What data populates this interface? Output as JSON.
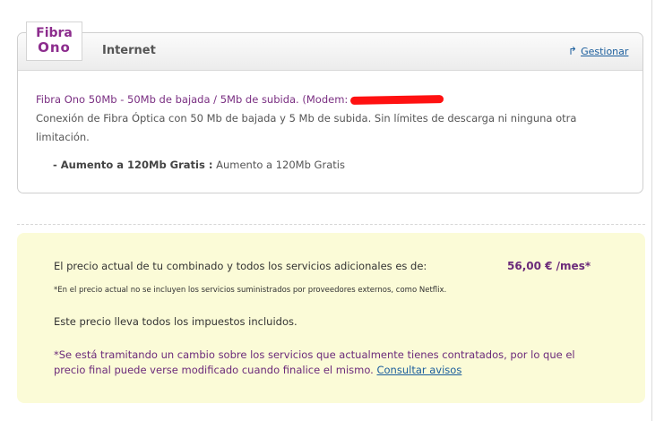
{
  "logo": {
    "line1": "Fibra",
    "line2": "Ono"
  },
  "service": {
    "title": "Internet",
    "manage_label": "Gestionar",
    "manage_icon": "share-arrow-icon",
    "line1": "Fibra Ono 50Mb - 50Mb de bajada / 5Mb de subida. (Modem:",
    "description": "Conexión de Fibra Óptica con 50 Mb de bajada y 5 Mb de subida. Sin límites de descarga ni ninguna otra limitación.",
    "addon_label": "- Aumento a 120Mb Gratis :",
    "addon_value": "Aumento a 120Mb Gratis"
  },
  "pricing": {
    "label": "El precio actual de tu combinado y todos los servicios adicionales es de:",
    "value": "56,00 € /mes*",
    "note": "*En el precio actual no se incluyen los servicios suministrados por proveedores externos, como Netflix.",
    "tax_note": "Este precio lleva todos los impuestos incluidos.",
    "change_note": "*Se está tramitando un cambio sobre los servicios que actualmente tienes contratados, por lo que el precio final puede verse modificado cuando finalice el mismo.",
    "avisos_link": "Consultar avisos"
  },
  "colors": {
    "brand_purple": "#8c2c8d",
    "link_blue": "#1a5d9c",
    "price_box_bg": "#fbfbd7",
    "redaction_red": "#ff1111"
  }
}
